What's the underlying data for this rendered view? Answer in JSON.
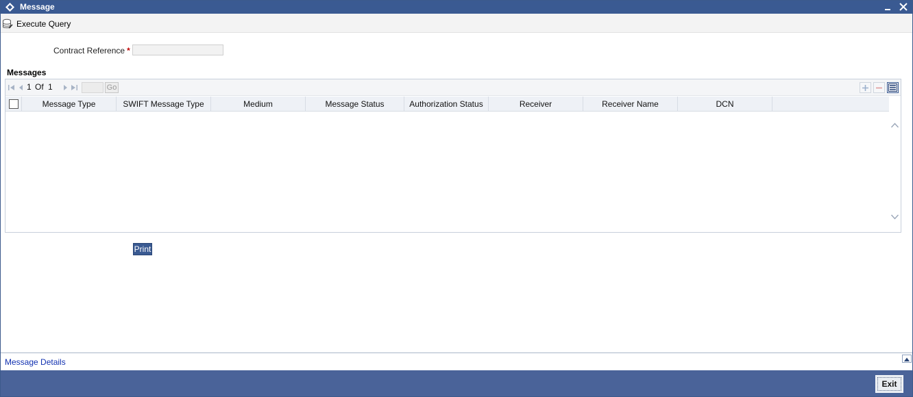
{
  "window": {
    "title": "Message"
  },
  "toolbar": {
    "execute_query_label": "Execute Query"
  },
  "form": {
    "contract_reference_label": "Contract Reference",
    "required_marker": "*",
    "contract_reference_value": ""
  },
  "messages_section": {
    "title": "Messages",
    "pagination": {
      "current_page": "1",
      "of_label": "Of",
      "total_pages": "1",
      "go_label": "Go"
    },
    "columns": [
      "Message Type",
      "SWIFT Message Type",
      "Medium",
      "Message Status",
      "Authorization Status",
      "Receiver",
      "Receiver Name",
      "DCN"
    ],
    "rows": []
  },
  "actions": {
    "print_label": "Print"
  },
  "footer": {
    "message_details_link": "Message Details",
    "exit_label": "Exit"
  },
  "colors": {
    "title_bar": "#3a5a92",
    "bottom_bar": "#4a6399",
    "link": "#1030b0",
    "required": "#c00000"
  }
}
